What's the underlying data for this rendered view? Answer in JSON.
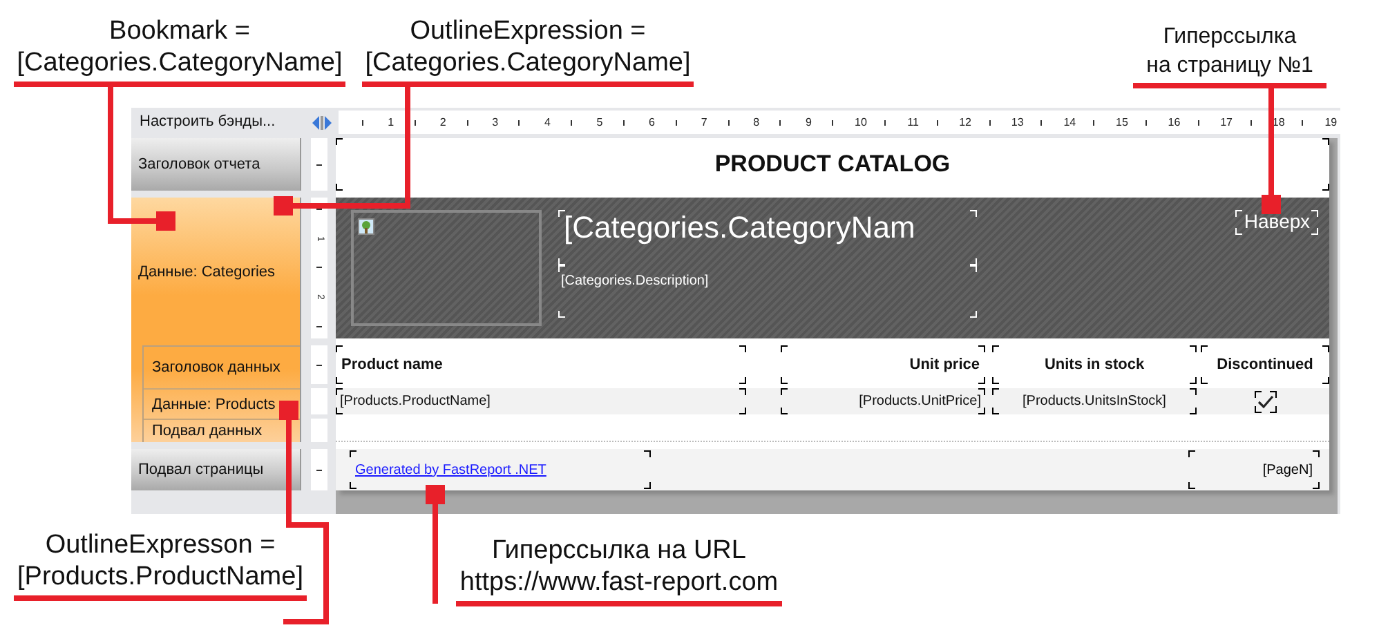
{
  "annotations": [
    {
      "lines": [
        "Bookmark =",
        "[Categories.CategoryName]"
      ]
    },
    {
      "lines": [
        "OutlineExpression =",
        "[Categories.CategoryName]"
      ]
    },
    {
      "lines": [
        "Гиперссылка",
        "на страницу №1"
      ]
    },
    {
      "lines": [
        "OutlineExpresson =",
        "[Products.ProductName]"
      ]
    },
    {
      "lines": [
        "Гиперссылка на URL",
        "https://www.fast-report.com"
      ]
    }
  ],
  "designer": {
    "configure_bands": "Настроить бэнды...",
    "ruler": [
      "1",
      "2",
      "3",
      "4",
      "5",
      "6",
      "7",
      "8",
      "9",
      "10",
      "11",
      "12",
      "13",
      "14",
      "15",
      "16",
      "17",
      "18",
      "19"
    ],
    "vertical_ruler": [
      "1",
      "2"
    ],
    "band_tree": [
      {
        "label": "Заголовок отчета",
        "kind": "page_band"
      },
      {
        "label": "Данные: Categories",
        "kind": "data_band",
        "children": [
          {
            "label": "Заголовок данных"
          },
          {
            "label": "Данные: Products"
          },
          {
            "label": "Подвал данных"
          }
        ]
      },
      {
        "label": "Подвал страницы",
        "kind": "page_band"
      }
    ],
    "report": {
      "title": "PRODUCT CATALOG",
      "category_name": "[Categories.CategoryNam",
      "category_description": "[Categories.Description]",
      "top_link": "Наверх",
      "columns": [
        {
          "header": "Product name",
          "field": "[Products.ProductName]",
          "kind": "text"
        },
        {
          "header": "Unit price",
          "field": "[Products.UnitPrice]",
          "kind": "text"
        },
        {
          "header": "Units in stock",
          "field": "[Products.UnitsInStock]",
          "kind": "text"
        },
        {
          "header": "Discontinued",
          "kind": "checkbox",
          "checked": true
        }
      ],
      "footer_link": "Generated by FastReport .NET",
      "page_number": "[PageN]"
    }
  }
}
